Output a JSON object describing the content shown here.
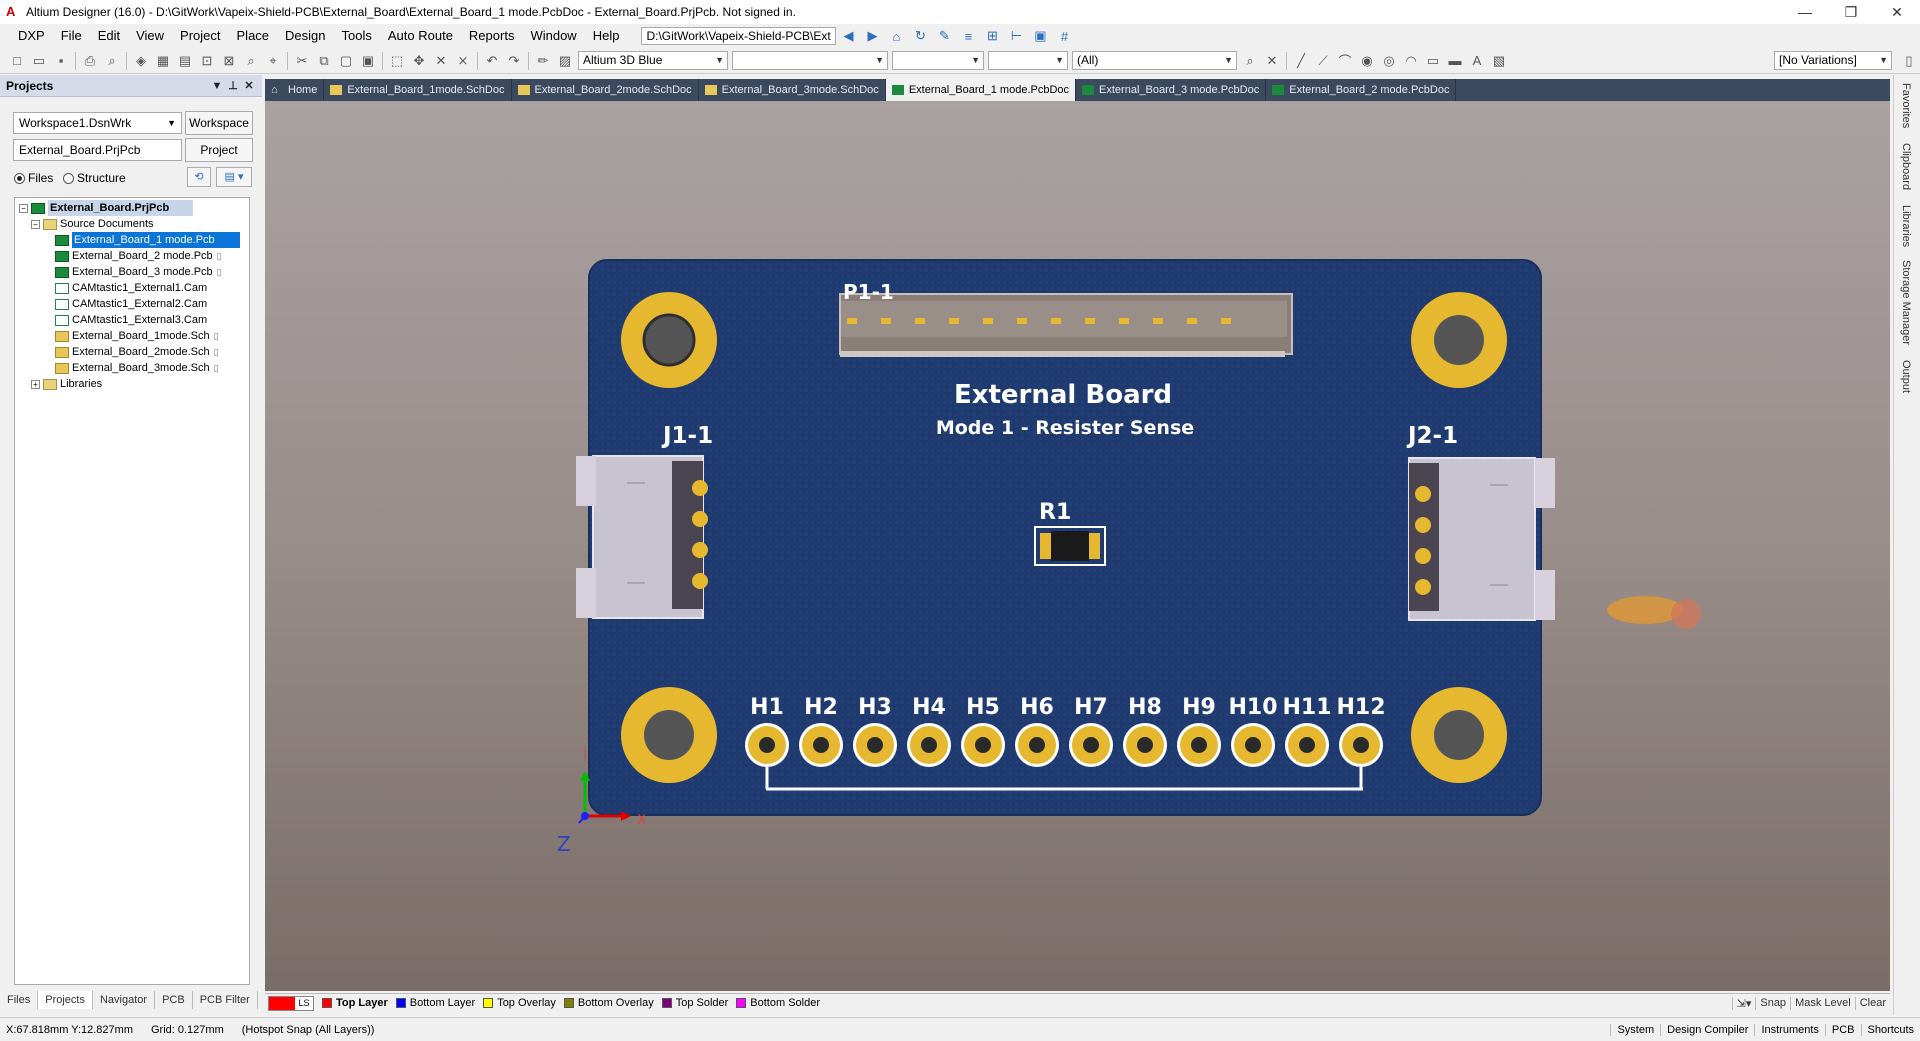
{
  "title_bar": {
    "title": "Altium Designer (16.0) - D:\\GitWork\\Vapeix-Shield-PCB\\External_Board\\External_Board_1 mode.PcbDoc - External_Board.PrjPcb. Not signed in.",
    "minimize": "—",
    "restore": "❐",
    "close": "✕"
  },
  "menu": {
    "items": [
      "DXP",
      "File",
      "Edit",
      "View",
      "Project",
      "Place",
      "Design",
      "Tools",
      "Auto Route",
      "Reports",
      "Window",
      "Help"
    ],
    "path": "D:\\GitWork\\Vapeix-Shield-PCB\\Ext"
  },
  "toolbar": {
    "view_config": "Altium 3D Blue",
    "filter": "(All)",
    "variations": "[No Variations]"
  },
  "projects_panel": {
    "title": "Projects",
    "workspace_value": "Workspace1.DsnWrk",
    "workspace_button": "Workspace",
    "project_value": "External_Board.PrjPcb",
    "project_button": "Project",
    "radio_files": "Files",
    "radio_structure": "Structure",
    "tree": {
      "project": "External_Board.PrjPcb",
      "folder_source": "Source Documents",
      "docs": [
        {
          "name": "External_Board_1 mode.Pcb",
          "type": "pcb"
        },
        {
          "name": "External_Board_2 mode.Pcb",
          "type": "pcb"
        },
        {
          "name": "External_Board_3 mode.Pcb",
          "type": "pcb"
        },
        {
          "name": "CAMtastic1_External1.Cam",
          "type": "cam"
        },
        {
          "name": "CAMtastic1_External2.Cam",
          "type": "cam"
        },
        {
          "name": "CAMtastic1_External3.Cam",
          "type": "cam"
        },
        {
          "name": "External_Board_1mode.Sch",
          "type": "sch"
        },
        {
          "name": "External_Board_2mode.Sch",
          "type": "sch"
        },
        {
          "name": "External_Board_3mode.Sch",
          "type": "sch"
        }
      ],
      "folder_libraries": "Libraries"
    },
    "bottom_tabs": [
      "Files",
      "Projects",
      "Navigator",
      "PCB",
      "PCB Filter"
    ]
  },
  "doc_tabs": [
    {
      "label": "Home",
      "type": "home"
    },
    {
      "label": "External_Board_1mode.SchDoc",
      "type": "sch"
    },
    {
      "label": "External_Board_2mode.SchDoc",
      "type": "sch"
    },
    {
      "label": "External_Board_3mode.SchDoc",
      "type": "sch"
    },
    {
      "label": "External_Board_1 mode.PcbDoc",
      "type": "pcb",
      "active": true
    },
    {
      "label": "External_Board_3 mode.PcbDoc",
      "type": "pcb"
    },
    {
      "label": "External_Board_2 mode.PcbDoc",
      "type": "pcb"
    }
  ],
  "pcb": {
    "board_title": "External Board",
    "board_subtitle": "Mode 1 -  Resister Sense",
    "designators": {
      "p1": "P1-1",
      "j1": "J1-1",
      "j2": "J2-1",
      "r1": "R1"
    },
    "headers": [
      "H1",
      "H2",
      "H3",
      "H4",
      "H5",
      "H6",
      "H7",
      "H8",
      "H9",
      "H10",
      "H11",
      "H12"
    ],
    "axis_z": "Z",
    "axis_x": "X",
    "board_color": "#1f3a6e",
    "pad_color": "#e6b830"
  },
  "right_rail": [
    "Favorites",
    "Clipboard",
    "Libraries",
    "Storage Manager",
    "Output"
  ],
  "layer_bar": {
    "ls": "LS",
    "layers": [
      {
        "name": "Top Layer",
        "color": "#ff0000",
        "active": true
      },
      {
        "name": "Bottom Layer",
        "color": "#0000ff"
      },
      {
        "name": "Top Overlay",
        "color": "#ffff00"
      },
      {
        "name": "Bottom Overlay",
        "color": "#808000"
      },
      {
        "name": "Top Solder",
        "color": "#800080"
      },
      {
        "name": "Bottom Solder",
        "color": "#ff00ff"
      }
    ],
    "right": [
      "Snap",
      "Mask Level",
      "Clear"
    ]
  },
  "status_bar": {
    "coords": "X:67.818mm Y:12.827mm",
    "grid": "Grid: 0.127mm",
    "snap": "(Hotspot Snap (All Layers))",
    "right": [
      "System",
      "Design Compiler",
      "Instruments",
      "PCB",
      "Shortcuts"
    ]
  }
}
